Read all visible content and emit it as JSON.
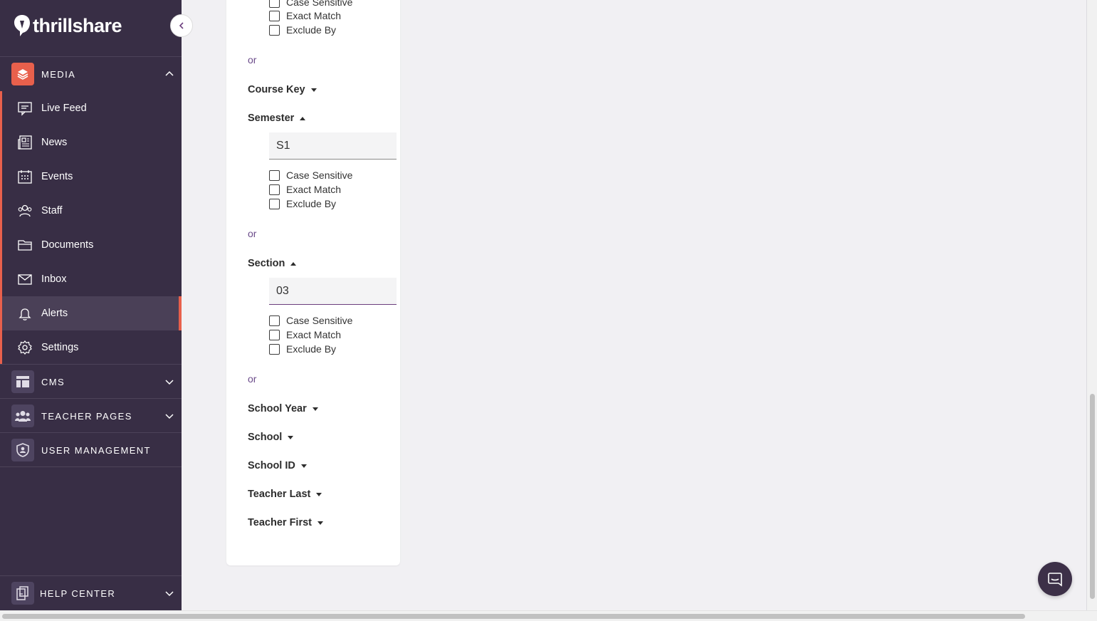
{
  "brand": {
    "name": "thrillshare"
  },
  "sidebar": {
    "collapse_label": "",
    "sections": {
      "media": {
        "label": "MEDIA"
      },
      "cms": {
        "label": "CMS"
      },
      "teacher_pages": {
        "label": "TEACHER PAGES"
      },
      "user_management": {
        "label": "USER MANAGEMENT"
      },
      "help_center": {
        "label": "HELP CENTER"
      }
    },
    "media_items": [
      {
        "label": "Live Feed",
        "icon": "live-feed-icon"
      },
      {
        "label": "News",
        "icon": "news-icon"
      },
      {
        "label": "Events",
        "icon": "calendar-icon"
      },
      {
        "label": "Staff",
        "icon": "staff-icon"
      },
      {
        "label": "Documents",
        "icon": "folder-icon"
      },
      {
        "label": "Inbox",
        "icon": "mail-icon"
      },
      {
        "label": "Alerts",
        "icon": "bell-icon",
        "active": true
      },
      {
        "label": "Settings",
        "icon": "gear-icon"
      }
    ],
    "active_item": "Alerts",
    "accent_color": "#e8604c"
  },
  "filter_panel": {
    "top_options": [
      "Case Sensitive",
      "Exact Match",
      "Exclude By"
    ],
    "or_label": "or",
    "fields": {
      "course_key": {
        "label": "Course Key",
        "expanded": false
      },
      "semester": {
        "label": "Semester",
        "expanded": true,
        "value": "S1",
        "options": [
          "Case Sensitive",
          "Exact Match",
          "Exclude By"
        ]
      },
      "section": {
        "label": "Section",
        "expanded": true,
        "value": "03",
        "options": [
          "Case Sensitive",
          "Exact Match",
          "Exclude By"
        ]
      },
      "school_year": {
        "label": "School Year",
        "expanded": false
      },
      "school": {
        "label": "School",
        "expanded": false
      },
      "school_id": {
        "label": "School ID",
        "expanded": false
      },
      "teacher_last": {
        "label": "Teacher Last",
        "expanded": false
      },
      "teacher_first": {
        "label": "Teacher First",
        "expanded": false
      }
    }
  },
  "chat": {
    "icon": "chat-icon"
  }
}
